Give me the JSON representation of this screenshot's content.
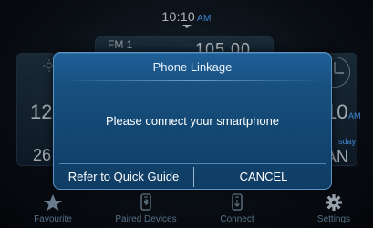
{
  "status_bar": {
    "time": "10:10",
    "ampm": "AM"
  },
  "background": {
    "radio_band": "FM 1",
    "radio_freq": "105.00",
    "left_value_1": "12",
    "left_value_2": "26",
    "right_value_1": "10",
    "right_ampm": "AM",
    "right_day_fragment": "sday",
    "right_value_2": "AN"
  },
  "dialog": {
    "title": "Phone Linkage",
    "message": "Please connect your smartphone",
    "guide_button": "Refer to Quick Guide",
    "cancel_button": "CANCEL"
  },
  "bottom_nav": {
    "items": [
      {
        "label": "Favourite",
        "icon": "star-icon"
      },
      {
        "label": "Paired Devices",
        "icon": "phone-icon"
      },
      {
        "label": "Connect",
        "icon": "phone-connect-icon"
      },
      {
        "label": "Settings",
        "icon": "gear-icon"
      }
    ]
  },
  "colors": {
    "accent": "#4fa3ff",
    "dialog_bg": "#17507f",
    "nav_text": "#6a89a3"
  }
}
